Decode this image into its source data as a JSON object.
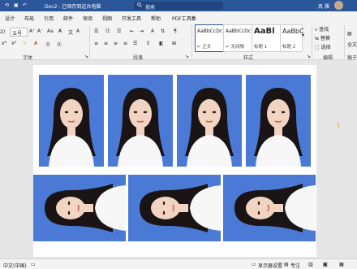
{
  "titlebar": {
    "doc_title": "Doc2 - 已保存到这台电脑",
    "search_placeholder": "搜索",
    "user_name": "风 雅"
  },
  "tabs": [
    "设计",
    "布局",
    "引用",
    "邮件",
    "审阅",
    "视图",
    "开发工具",
    "帮助",
    "PDF工具集"
  ],
  "ribbon": {
    "font_name": "五号",
    "font_size": "2)",
    "groups": {
      "font": "字体",
      "paragraph": "段落",
      "styles": "样式",
      "editing": "编辑",
      "right": "稿子"
    },
    "styles": [
      {
        "sample": "AaBbCcDc",
        "name": "↵ 正文"
      },
      {
        "sample": "AaBbCcDc",
        "name": "↵ 无间隔"
      },
      {
        "sample": "AaBl",
        "name": "标题 1"
      },
      {
        "sample": "AaBbC",
        "name": "标题 2"
      }
    ],
    "editing": {
      "find": "查找",
      "replace": "替换",
      "select": "选择"
    },
    "right_label": "全文"
  },
  "status": {
    "language": "中文(中国)",
    "display_settings": "显示器设置",
    "focus": "专注"
  },
  "photos": {
    "count_top": 4,
    "count_bottom": 3
  },
  "colors": {
    "titlebar": "#2b579a",
    "photo_bg": "#4a7ad6",
    "accent": "#2b579a"
  }
}
